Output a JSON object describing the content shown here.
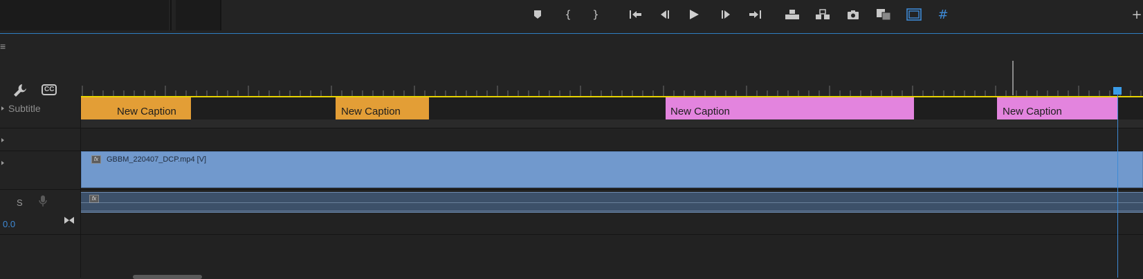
{
  "toolbar": {
    "buttons": [
      {
        "name": "add-marker-button",
        "icon": "marker-icon"
      },
      {
        "name": "mark-in-button",
        "icon": "mark-in-icon",
        "glyph": "{"
      },
      {
        "name": "mark-out-button",
        "icon": "mark-out-icon",
        "glyph": "}"
      },
      {
        "name": "go-to-in-button",
        "icon": "go-to-in-icon"
      },
      {
        "name": "step-back-button",
        "icon": "step-back-icon"
      },
      {
        "name": "play-button",
        "icon": "play-icon"
      },
      {
        "name": "step-forward-button",
        "icon": "step-forward-icon"
      },
      {
        "name": "go-to-out-button",
        "icon": "go-to-out-icon"
      },
      {
        "name": "lift-button",
        "icon": "lift-icon"
      },
      {
        "name": "extract-button",
        "icon": "extract-icon"
      },
      {
        "name": "export-frame-button",
        "icon": "camera-icon"
      },
      {
        "name": "comparison-view-button",
        "icon": "comparison-icon"
      },
      {
        "name": "safe-margins-button",
        "icon": "safe-margins-icon",
        "active": true
      },
      {
        "name": "grid-button",
        "icon": "grid-icon",
        "active": true,
        "glyph": "#"
      },
      {
        "name": "add-button",
        "icon": "plus-icon",
        "glyph": "+"
      }
    ],
    "accent_color": "#2f7fc4"
  },
  "timeline": {
    "menu_glyph": "≡",
    "cc_label": "CC",
    "tracks": {
      "subtitle": {
        "label": "Subtitle",
        "captions": [
          {
            "text": "New Caption",
            "color": "orange"
          },
          {
            "text": "New Caption",
            "color": "orange"
          },
          {
            "text": "New Caption",
            "color": "pink"
          },
          {
            "text": "New Caption",
            "color": "pink"
          }
        ]
      },
      "video": {
        "clip_name": "GBBM_220407_DCP.mp4 [V]",
        "fx_label": "fx",
        "clip_color": "#7199cd"
      },
      "audio": {
        "solo_label": "S",
        "fx_label": "fx",
        "volume": "0.0",
        "clip_color": "#3c5069"
      }
    },
    "colors": {
      "caption_orange": "#e39e36",
      "caption_pink": "#e384de",
      "playhead": "#3a9ce8",
      "work_area": "#e8d400"
    }
  }
}
